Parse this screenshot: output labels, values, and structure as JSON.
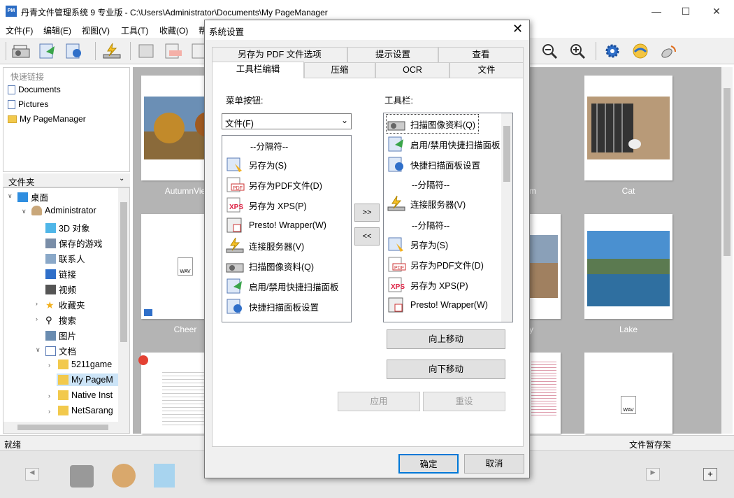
{
  "window": {
    "title": "丹青文件管理系统 9 专业版 - C:\\Users\\Administrator\\Documents\\My PageManager",
    "app_icon": "PM"
  },
  "menu": [
    "文件(F)",
    "编辑(E)",
    "视图(V)",
    "工具(T)",
    "收藏(O)",
    "帮"
  ],
  "quick_links": {
    "header": "快速链接",
    "items": [
      "Documents",
      "Pictures",
      "My PageManager"
    ]
  },
  "folder_panel": {
    "header": "文件夹"
  },
  "tree": [
    {
      "label": "桌面",
      "icon": "desktop-icon"
    },
    {
      "label": "Administrator",
      "icon": "user-icon"
    },
    {
      "label": "3D 对象",
      "icon": "cube-icon"
    },
    {
      "label": "保存的游戏",
      "icon": "games-icon"
    },
    {
      "label": "联系人",
      "icon": "contacts-icon"
    },
    {
      "label": "链接",
      "icon": "link-icon"
    },
    {
      "label": "视频",
      "icon": "video-icon"
    },
    {
      "label": "收藏夹",
      "icon": "star-icon"
    },
    {
      "label": "搜索",
      "icon": "search-icon"
    },
    {
      "label": "图片",
      "icon": "picture-icon"
    },
    {
      "label": "文档",
      "icon": "document-icon"
    },
    {
      "label": "5211game",
      "icon": "folder-icon"
    },
    {
      "label": "My PageM",
      "icon": "folder-icon"
    },
    {
      "label": "Native Inst",
      "icon": "folder-icon"
    },
    {
      "label": "NetSarang",
      "icon": "folder-icon"
    }
  ],
  "gallery": {
    "labels": [
      "AutumnVie",
      "rm",
      "Cat",
      "Cheer",
      "y",
      "Lake"
    ],
    "wav_label": "WAV"
  },
  "status": {
    "left": "就绪",
    "right": "文件暂存架"
  },
  "dialog": {
    "title": "系统设置",
    "tabs_row1": [
      "另存为 PDF 文件选项",
      "提示设置",
      "查看"
    ],
    "tabs_row2": [
      "工具栏编辑",
      "压缩",
      "OCR",
      "文件"
    ],
    "menu_buttons_label": "菜单按钮:",
    "toolbar_label": "工具栏:",
    "combo_value": "文件(F)",
    "left_list": [
      "--分隔符--",
      "另存为(S)",
      "另存为PDF文件(D)",
      "另存为 XPS(P)",
      "Presto! Wrapper(W)",
      "连接服务器(V)",
      "扫描图像资料(Q)",
      "启用/禁用快捷扫描面板",
      "快捷扫描面板设置"
    ],
    "right_list": [
      "扫描图像资料(Q)",
      "启用/禁用快捷扫描面板",
      "快捷扫描面板设置",
      "--分隔符--",
      "连接服务器(V)",
      "--分隔符--",
      "另存为(S)",
      "另存为PDF文件(D)",
      "另存为 XPS(P)",
      "Presto! Wrapper(W)"
    ],
    "add_btn": ">>",
    "remove_btn": "<<",
    "move_up": "向上移动",
    "move_down": "向下移动",
    "apply": "应用",
    "reset": "重设",
    "ok": "确定",
    "cancel": "取消"
  },
  "colors": {
    "accent": "#0078d7",
    "gallery_bg": "#b4b4b4",
    "folder": "#f2c94c"
  }
}
